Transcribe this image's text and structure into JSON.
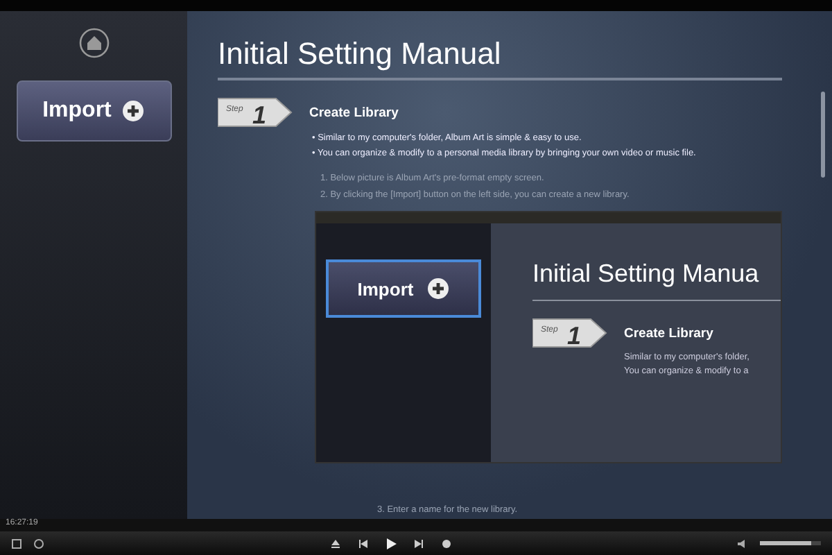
{
  "sidebar": {
    "import_button": {
      "label": "Import"
    }
  },
  "manual": {
    "title": "Initial Setting Manual",
    "step": {
      "badge_small": "Step",
      "badge_number": "1",
      "heading": "Create Library"
    },
    "bullets": [
      "• Similar to my computer's folder, Album Art is simple & easy to use.",
      "• You can organize & modify to a personal media library by bringing your own video or music file."
    ],
    "steps": [
      "1. Below picture is Album Art's pre-format empty screen.",
      "2. By clicking the [Import] button on the left side, you can create a new library."
    ],
    "preview": {
      "import_button": {
        "label": "Import"
      },
      "title": "Initial Setting Manua",
      "step": {
        "badge_small": "Step",
        "badge_number": "1",
        "heading": "Create Library"
      },
      "lines": [
        "Similar to my computer's folder,",
        "You can organize & modify to a"
      ]
    },
    "step_3": "3. Enter a name for the new library."
  },
  "player": {
    "time": "16:27:19",
    "volume": {
      "level": 0.85
    }
  }
}
